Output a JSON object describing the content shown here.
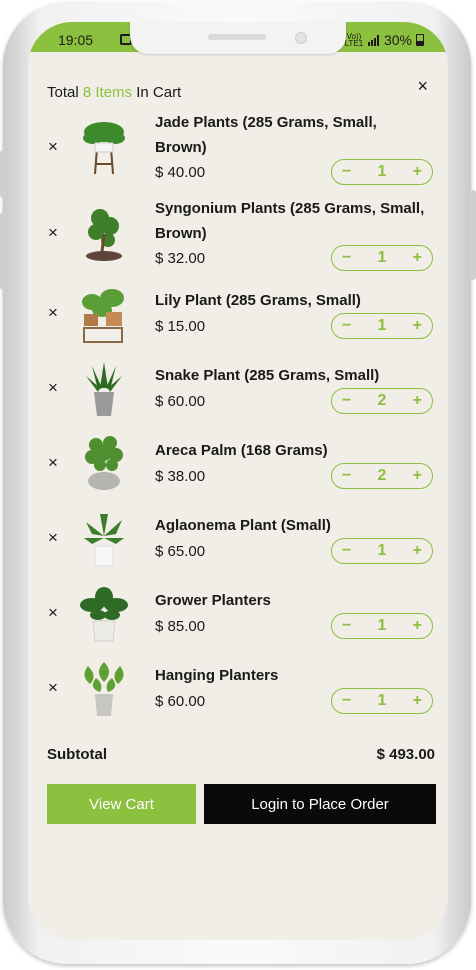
{
  "status_bar": {
    "time": "19:05",
    "network": "Vo)) LTE1",
    "battery": "30%"
  },
  "cart": {
    "header_prefix": "Total ",
    "item_count_text": "8 Items",
    "header_suffix": " In Cart",
    "close_icon": "×"
  },
  "items": [
    {
      "remove": "×",
      "name": "Jade Plants (285 Grams, Small, Brown)",
      "price": "$ 40.00",
      "qty": "1"
    },
    {
      "remove": "×",
      "name": "Syngonium Plants (285 Grams, Small, Brown)",
      "price": "$ 32.00",
      "qty": "1"
    },
    {
      "remove": "×",
      "name": "Lily Plant (285 Grams, Small)",
      "price": "$ 15.00",
      "qty": "1"
    },
    {
      "remove": "×",
      "name": "Snake Plant (285 Grams, Small)",
      "price": "$ 60.00",
      "qty": "2"
    },
    {
      "remove": "×",
      "name": "Areca Palm (168 Grams)",
      "price": "$ 38.00",
      "qty": "2"
    },
    {
      "remove": "×",
      "name": "Aglaonema Plant (Small)",
      "price": "$ 65.00",
      "qty": "1"
    },
    {
      "remove": "×",
      "name": "Grower Planters",
      "price": "$ 85.00",
      "qty": "1"
    },
    {
      "remove": "×",
      "name": "Hanging Planters",
      "price": "$ 60.00",
      "qty": "1"
    }
  ],
  "stepper": {
    "minus": "−",
    "plus": "+"
  },
  "summary": {
    "subtotal_label": "Subtotal",
    "subtotal_value": "$ 493.00"
  },
  "actions": {
    "view_cart_label": "View Cart",
    "login_label": "Login to Place Order"
  },
  "colors": {
    "accent": "#8cc03f",
    "background": "#f1ede7",
    "dark_button": "#0a0a0a"
  }
}
